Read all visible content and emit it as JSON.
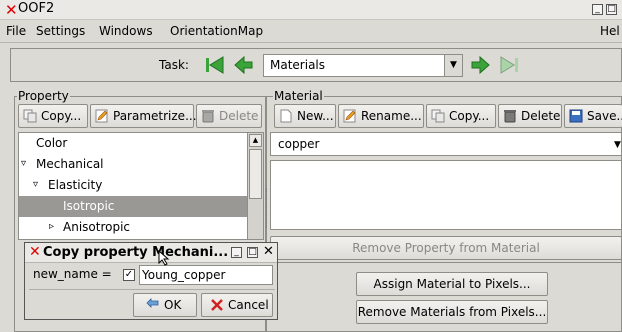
{
  "window": {
    "title": "OOF2",
    "help_partial": "Hel"
  },
  "menu": [
    "File",
    "Settings",
    "Windows",
    "OrientationMap"
  ],
  "task": {
    "label": "Task:",
    "value": "Materials"
  },
  "property": {
    "frame_label": "Property",
    "buttons": {
      "copy": "Copy...",
      "parametrize": "Parametrize...",
      "delete": "Delete"
    },
    "tree": [
      {
        "label": "Color",
        "indent": 0,
        "expander": ""
      },
      {
        "label": "Mechanical",
        "indent": 0,
        "expander": "▿"
      },
      {
        "label": "Elasticity",
        "indent": 1,
        "expander": "▿"
      },
      {
        "label": "Isotropic",
        "indent": 2,
        "expander": "",
        "selected": true
      },
      {
        "label": "Anisotropic",
        "indent": 2,
        "expander": "▹"
      }
    ]
  },
  "material": {
    "frame_label": "Material",
    "buttons": {
      "new": "New...",
      "rename": "Rename...",
      "copy": "Copy...",
      "delete": "Delete",
      "save": "Save..."
    },
    "current": "copper",
    "remove_property": "Remove Property from Material",
    "assign": "Assign Material to Pixels...",
    "remove_materials": "Remove Materials from Pixels..."
  },
  "dialog": {
    "title": "Copy property Mechani...",
    "field_label": "new_name =",
    "field_value": "Young_copper",
    "ok": "OK",
    "cancel": "Cancel"
  },
  "colors": {
    "close_red": "#e00000",
    "selection": "#9a9894",
    "window_bg": "#dcdad5"
  }
}
